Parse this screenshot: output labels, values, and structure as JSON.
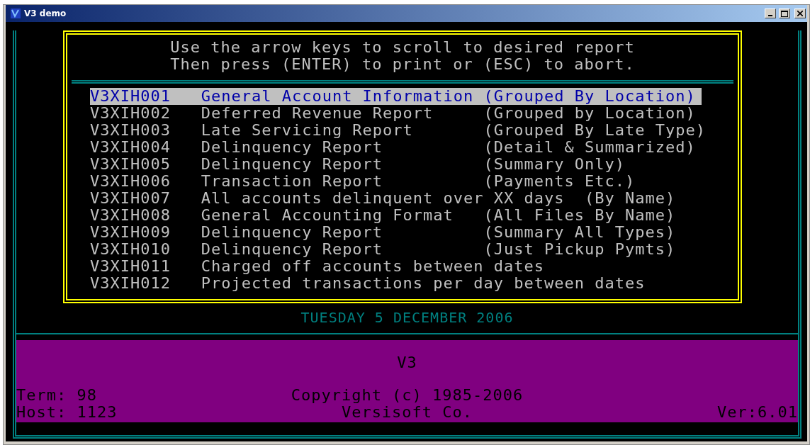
{
  "window": {
    "title": "V3 demo"
  },
  "instructions": [
    "Use the arrow keys to scroll to desired report",
    "Then press (ENTER) to print or (ESC) to abort."
  ],
  "reports": [
    {
      "text": "V3XIH001   General Account Information (Grouped By Location)",
      "selected": true
    },
    {
      "text": "V3XIH002   Deferred Revenue Report     (Grouped by Location)",
      "selected": false
    },
    {
      "text": "V3XIH003   Late Servicing Report       (Grouped By Late Type)",
      "selected": false
    },
    {
      "text": "V3XIH004   Delinquency Report          (Detail & Summarized)",
      "selected": false
    },
    {
      "text": "V3XIH005   Delinquency Report          (Summary Only)",
      "selected": false
    },
    {
      "text": "V3XIH006   Transaction Report          (Payments Etc.)",
      "selected": false
    },
    {
      "text": "V3XIH007   All accounts delinquent over XX days  (By Name)",
      "selected": false
    },
    {
      "text": "V3XIH008   General Accounting Format   (All Files By Name)",
      "selected": false
    },
    {
      "text": "V3XIH009   Delinquency Report          (Summary All Types)",
      "selected": false
    },
    {
      "text": "V3XIH010   Delinquency Report          (Just Pickup Pymts)",
      "selected": false
    },
    {
      "text": "V3XIH011   Charged off accounts between dates",
      "selected": false
    },
    {
      "text": "V3XIH012   Projected transactions per day between dates",
      "selected": false
    }
  ],
  "date": "TUESDAY 5 DECEMBER 2006",
  "footer": {
    "product": "V3",
    "term": "Term: 98",
    "host": "Host: 1123",
    "copyright": "Copyright (c) 1985-2006",
    "company": "Versisoft Co.",
    "version": "Ver:6.01"
  }
}
